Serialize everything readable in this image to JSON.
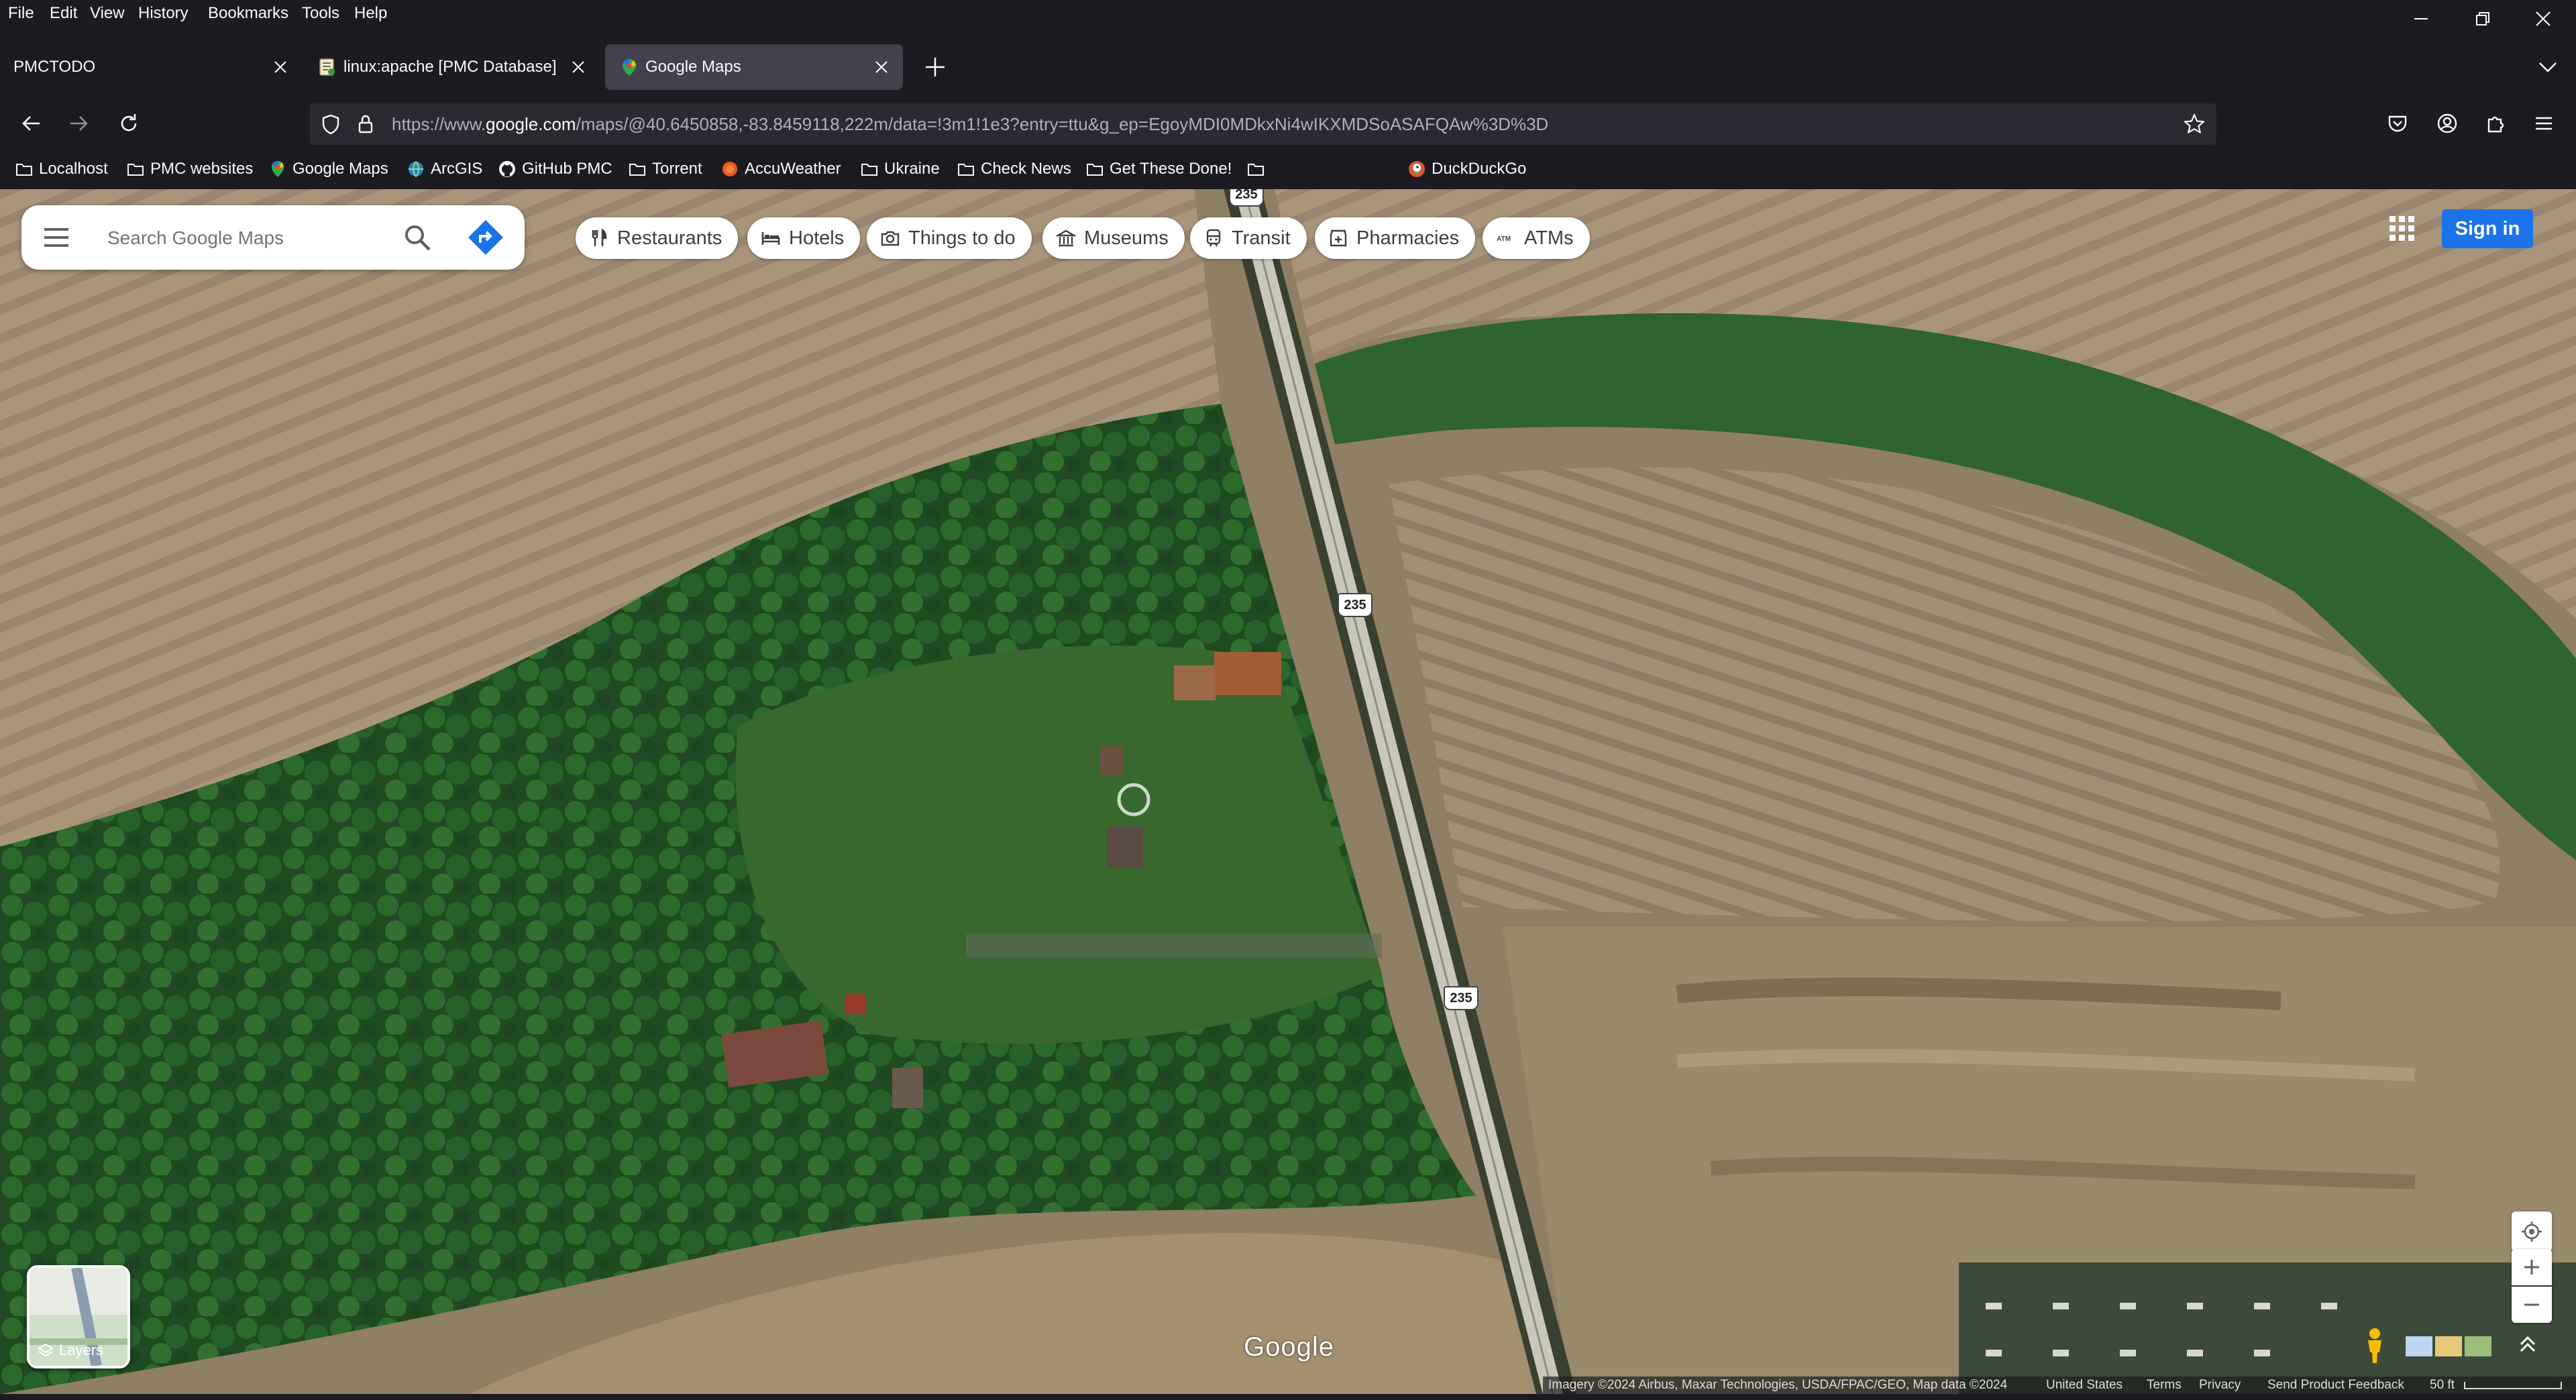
{
  "menu": [
    "File",
    "Edit",
    "View",
    "History",
    "Bookmarks",
    "Tools",
    "Help"
  ],
  "tabs": [
    {
      "title": "PMCTODO"
    },
    {
      "title": "linux:apache [PMC Database]"
    },
    {
      "title": "Google Maps"
    }
  ],
  "url": {
    "prefix": "https://www.",
    "domain": "google.com",
    "path": "/maps/@40.6450858,-83.8459118,222m/data=!3m1!1e3?entry=ttu&g_ep=EgoyMDI0MDkxNi4wIKXMDSoASAFQAw%3D%3D"
  },
  "bookmarks": [
    {
      "label": "Localhost",
      "icon": "folder-icon"
    },
    {
      "label": "PMC websites",
      "icon": "folder-icon"
    },
    {
      "label": "Google Maps",
      "icon": "maps-pin-icon"
    },
    {
      "label": "ArcGIS",
      "icon": "globe-icon"
    },
    {
      "label": "GitHub PMC",
      "icon": "github-icon"
    },
    {
      "label": "Torrent",
      "icon": "folder-icon"
    },
    {
      "label": "AccuWeather",
      "icon": "weather-icon"
    },
    {
      "label": "Ukraine",
      "icon": "folder-icon"
    },
    {
      "label": "Check News",
      "icon": "folder-icon"
    },
    {
      "label": "Get These Done!",
      "icon": "folder-icon"
    },
    {
      "label": "",
      "icon": "folder-icon"
    },
    {
      "label": "DuckDuckGo",
      "icon": "duckduckgo-icon"
    }
  ],
  "map": {
    "search_placeholder": "Search Google Maps",
    "chips": [
      {
        "label": "Restaurants",
        "icon": "fork-knife-icon"
      },
      {
        "label": "Hotels",
        "icon": "bed-icon"
      },
      {
        "label": "Things to do",
        "icon": "camera-icon"
      },
      {
        "label": "Museums",
        "icon": "museum-icon"
      },
      {
        "label": "Transit",
        "icon": "train-icon"
      },
      {
        "label": "Pharmacies",
        "icon": "pharmacy-icon"
      },
      {
        "label": "ATMs",
        "icon": "atm-icon"
      }
    ],
    "signin_label": "Sign in",
    "route_shields": [
      "235",
      "235",
      "235"
    ],
    "layers_label": "Layers",
    "logo_text": "Google",
    "attribution": {
      "imagery": "Imagery ©2024 Airbus, Maxar Technologies, USDA/FPAC/GEO, Map data ©2024",
      "country": "United States",
      "terms": "Terms",
      "privacy": "Privacy",
      "feedback": "Send Product Feedback",
      "scale": "50 ft"
    },
    "accent_color": "#1a73e8"
  },
  "browser_colors": {
    "chrome": "#1c1b22",
    "active_tab": "#42414d",
    "urlbar": "#2b2a33"
  }
}
